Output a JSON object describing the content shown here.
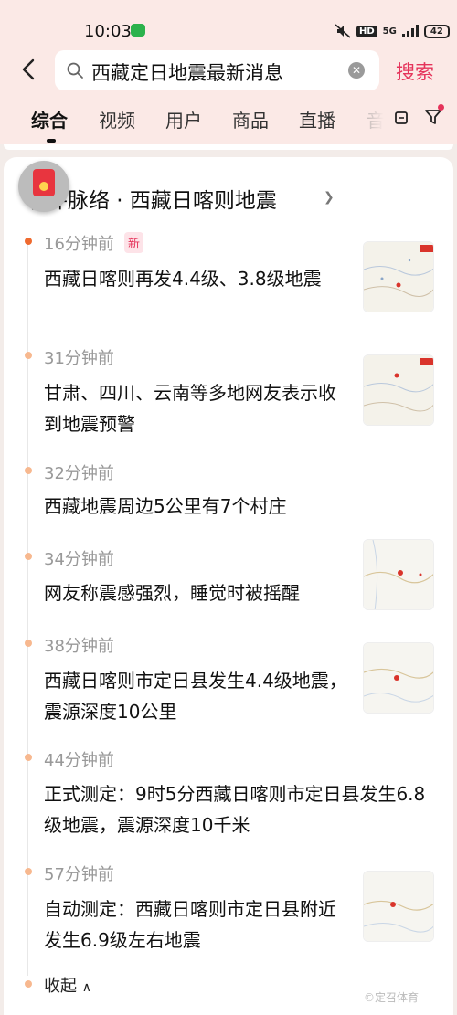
{
  "status_bar": {
    "time": "10:03",
    "network": "5G",
    "hd": "HD",
    "battery": "42"
  },
  "search": {
    "query": "西藏定日地震最新消息",
    "search_label": "搜索"
  },
  "tabs": [
    "综合",
    "视频",
    "用户",
    "商品",
    "直播",
    "音"
  ],
  "card": {
    "title": "事件脉络 · 西藏日喀则地震",
    "new_badge": "新",
    "items": [
      {
        "time": "16分钟前",
        "text": "西藏日喀则再发4.4级、3.8级地震"
      },
      {
        "time": "31分钟前",
        "text": "甘肃、四川、云南等多地网友表示收到地震预警"
      },
      {
        "time": "32分钟前",
        "text": "西藏地震周边5公里有7个村庄"
      },
      {
        "time": "34分钟前",
        "text": "网友称震感强烈，睡觉时被摇醒"
      },
      {
        "time": "38分钟前",
        "text": "西藏日喀则市定日县发生4.4级地震，震源深度10公里"
      },
      {
        "time": "44分钟前",
        "text": "正式测定：9时5分西藏日喀则市定日县发生6.8级地震，震源深度10千米"
      },
      {
        "time": "57分钟前",
        "text": "自动测定：西藏日喀则市定日县附近发生6.9级左右地震"
      }
    ],
    "collapse_label": "收起"
  },
  "watermark": "©定召体育",
  "colors": {
    "accent": "#e5335a",
    "header_bg": "#fbe9e6",
    "timeline_dot": "#ef6a2f"
  },
  "icons": [
    "back-arrow-icon",
    "search-icon",
    "clear-icon",
    "filter-icon",
    "red-packet-icon",
    "chevron-right-icon",
    "chevron-up-icon",
    "map-thumbnail"
  ]
}
